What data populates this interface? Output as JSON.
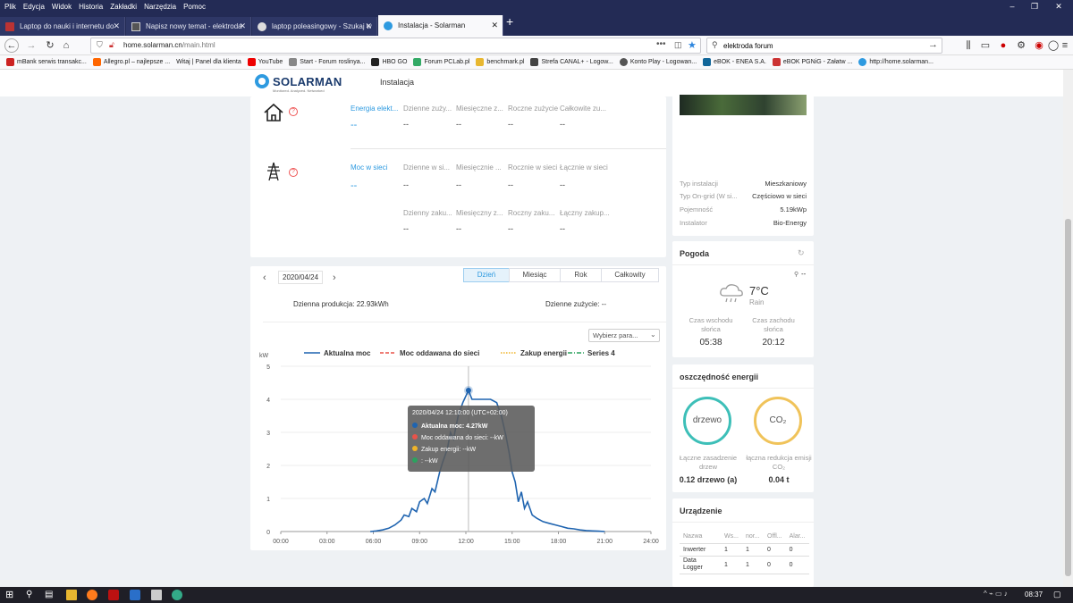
{
  "browser": {
    "menu": [
      "Plik",
      "Edycja",
      "Widok",
      "Historia",
      "Zakładki",
      "Narzędzia",
      "Pomoc"
    ],
    "tabs": [
      {
        "title": "Laptop do nauki i internetu do"
      },
      {
        "title": "Napisz nowy temat - elektroda"
      },
      {
        "title": "laptop poleasingowy - Szukaj w"
      },
      {
        "title": "Instalacja - Solarman"
      }
    ],
    "url_host": "home.solarman.cn",
    "url_path": "/main.html",
    "search_value": "elektroda forum",
    "bookmarks": [
      "mBank serwis transakc...",
      "Allegro.pl – najlepsze ...",
      "Witaj | Panel dla klienta",
      "YouTube",
      "Start - Forum roslinya...",
      "HBO GO",
      "Forum PCLab.pl",
      "benchmark.pl",
      "Strefa CANAL+ - Logow...",
      "Konto Play - Logowan...",
      "eBOK - ENEA S.A.",
      "eBOK PGNiG - Załatw ...",
      "http://home.solarman..."
    ]
  },
  "header": {
    "logo": "SOLARMAN",
    "logo_sub": "Monitored. Analyzed. Networked",
    "nav": "Instalacja"
  },
  "energy_top": {
    "cols": [
      "Energia elekt...",
      "Dzienne zuży...",
      "Miesięczne z...",
      "Roczne zużycie",
      "Całkowite zu..."
    ],
    "vals": [
      "--",
      "--",
      "--",
      "--",
      "--"
    ]
  },
  "grid_top": {
    "cols": [
      "Moc w sieci",
      "Dzienne w si...",
      "Miesięcznie ...",
      "Rocznie w sieci",
      "Łącznie w sieci"
    ],
    "vals": [
      "--",
      "--",
      "--",
      "--",
      "--"
    ],
    "cols2": [
      "Dzienny zaku...",
      "Miesięczny z...",
      "Roczny zaku...",
      "Łączny zakup..."
    ],
    "vals2": [
      "--",
      "--",
      "--",
      "--"
    ]
  },
  "chart_panel": {
    "date": "2020/04/24",
    "tabs": [
      "Dzień",
      "Miesiąc",
      "Rok",
      "Całkowity"
    ],
    "active_tab": "Dzień",
    "daily_production": "Dzienna produkcja: 22.93kWh",
    "daily_consumption": "Dzienne zużycie: --",
    "dropdown": "Wybierz para...",
    "tooltip": {
      "time": "2020/04/24 12:10:00 (UTC+02:00)",
      "lines": [
        "Aktualna moc:  4.27kW",
        "Moc oddawana do sieci:  --kW",
        "Zakup energii:  --kW",
        ":  --kW"
      ],
      "colors": [
        "#1f64b0",
        "#e8534a",
        "#f0b429",
        "#2ca25f"
      ]
    }
  },
  "chart_data": {
    "type": "line",
    "ylabel": "kW",
    "ylim": [
      0,
      5
    ],
    "yticks": [
      0,
      1,
      2,
      3,
      4,
      5
    ],
    "xticks": [
      "00:00",
      "03:00",
      "06:00",
      "09:00",
      "12:00",
      "15:00",
      "18:00",
      "21:00",
      "24:00"
    ],
    "xlim_hours": [
      0,
      24
    ],
    "legend_position": "top",
    "series": [
      {
        "name": "Aktualna moc",
        "color": "#1f64b0",
        "dash": "solid",
        "x": [
          5.8,
          6.2,
          6.6,
          7.0,
          7.4,
          7.8,
          8.0,
          8.3,
          8.5,
          8.8,
          9.0,
          9.3,
          9.5,
          9.8,
          10.0,
          10.3,
          10.5,
          10.8,
          11.0,
          11.2,
          11.5,
          11.8,
          12.0,
          12.17,
          12.4,
          12.8,
          13.2,
          13.6,
          14.0,
          14.3,
          14.6,
          14.8,
          15.0,
          15.2,
          15.4,
          15.6,
          15.8,
          16.0,
          16.3,
          16.6,
          17.0,
          17.4,
          17.8,
          18.2,
          18.6,
          19.0,
          19.4,
          19.8,
          20.2,
          20.6,
          21.0
        ],
        "y": [
          0,
          0.02,
          0.05,
          0.1,
          0.2,
          0.35,
          0.5,
          0.45,
          0.7,
          0.6,
          0.9,
          1.0,
          0.85,
          1.3,
          1.2,
          1.8,
          2.1,
          2.5,
          3.0,
          2.8,
          3.5,
          3.9,
          4.1,
          4.27,
          4.0,
          4.0,
          4.0,
          4.0,
          3.9,
          3.5,
          2.9,
          2.4,
          1.8,
          1.5,
          0.9,
          1.2,
          0.7,
          0.9,
          0.5,
          0.4,
          0.3,
          0.25,
          0.2,
          0.15,
          0.1,
          0.08,
          0.05,
          0.03,
          0.02,
          0.01,
          0
        ]
      },
      {
        "name": "Moc oddawana do sieci",
        "color": "#e8534a",
        "dash": "dashed",
        "x": [],
        "y": []
      },
      {
        "name": "Zakup energii",
        "color": "#f0b429",
        "dash": "dotted",
        "x": [],
        "y": []
      },
      {
        "name": "Series 4",
        "color": "#2ca25f",
        "dash": "dashdot",
        "x": [],
        "y": []
      }
    ],
    "highlight": {
      "x": 12.17,
      "y": 4.27
    }
  },
  "install_info": {
    "rows": [
      [
        "Typ instalacji",
        "Mieszkaniowy"
      ],
      [
        "Typ On-grid (W si...",
        "Częściowo w sieci"
      ],
      [
        "Pojemność",
        "5.19kWp"
      ],
      [
        "Instalator",
        "Bio-Energy"
      ]
    ]
  },
  "weather": {
    "title": "Pogoda",
    "loc": "--",
    "temp": "7°C",
    "cond": "Rain",
    "sunrise_label": "Czas wschodu słońca",
    "sunset_label": "Czas zachodu słońca",
    "sunrise": "05:38",
    "sunset": "20:12"
  },
  "savings": {
    "title": "oszczędność energii",
    "tree": "drzewo",
    "co2": "CO₂",
    "tree_label": "Łączne zasadzenie drzew",
    "co2_label": "łączna redukcja emisji CO₂",
    "tree_val": "0.12 drzewo (a)",
    "co2_val": "0.04 t",
    "tree_color": "#3dbfb8",
    "co2_color": "#f0c35a"
  },
  "devices": {
    "title": "Urządzenie",
    "headers": [
      "Nazwa",
      "Ws...",
      "nor...",
      "Offl...",
      "Alar..."
    ],
    "rows": [
      [
        "Inwerter",
        "1",
        "1",
        "0",
        "0"
      ],
      [
        "Data Logger",
        "1",
        "1",
        "0",
        "0"
      ]
    ]
  },
  "taskbar": {
    "time": "08:37"
  }
}
